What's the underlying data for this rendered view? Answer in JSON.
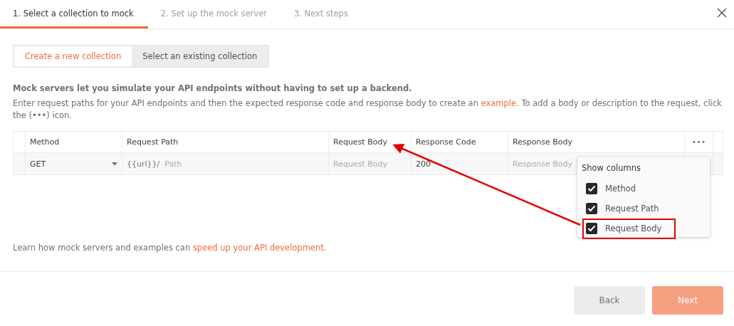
{
  "steps": [
    {
      "label": "1. Select a collection to mock",
      "selected": true
    },
    {
      "label": "2. Set up the mock server",
      "selected": false
    },
    {
      "label": "3. Next steps",
      "selected": false
    }
  ],
  "source_tabs": [
    {
      "label": "Create a new collection",
      "selected": true
    },
    {
      "label": "Select an existing collection",
      "selected": false
    }
  ],
  "intro": "Mock servers let you simulate your API endpoints without having to set up a backend.",
  "description": {
    "before": "Enter request paths for your API endpoints and then the expected response code and response body to create an ",
    "link": "example.",
    "after": " To add a body or description to the request, click the (•••) icon."
  },
  "table": {
    "columns": [
      "Method",
      "Request Path",
      "Request Body",
      "Response Code",
      "Response Body"
    ],
    "more": "•••",
    "rows": [
      {
        "method": "GET",
        "url_prefix": "{{url}}/",
        "path_placeholder": "Path",
        "request_body_placeholder": "Request Body",
        "response_code": "200",
        "response_body_placeholder": "Response Body"
      }
    ]
  },
  "column_menu": {
    "title": "Show columns",
    "items": [
      {
        "label": "Method",
        "checked": true
      },
      {
        "label": "Request Path",
        "checked": true
      },
      {
        "label": "Request Body",
        "checked": true
      }
    ]
  },
  "footer_note": {
    "before": "Learn how mock servers and examples can ",
    "link": "speed up your API development."
  },
  "buttons": [
    {
      "label": "Back",
      "kind": "secondary"
    },
    {
      "label": "Next",
      "kind": "primary",
      "disabled": true
    }
  ]
}
